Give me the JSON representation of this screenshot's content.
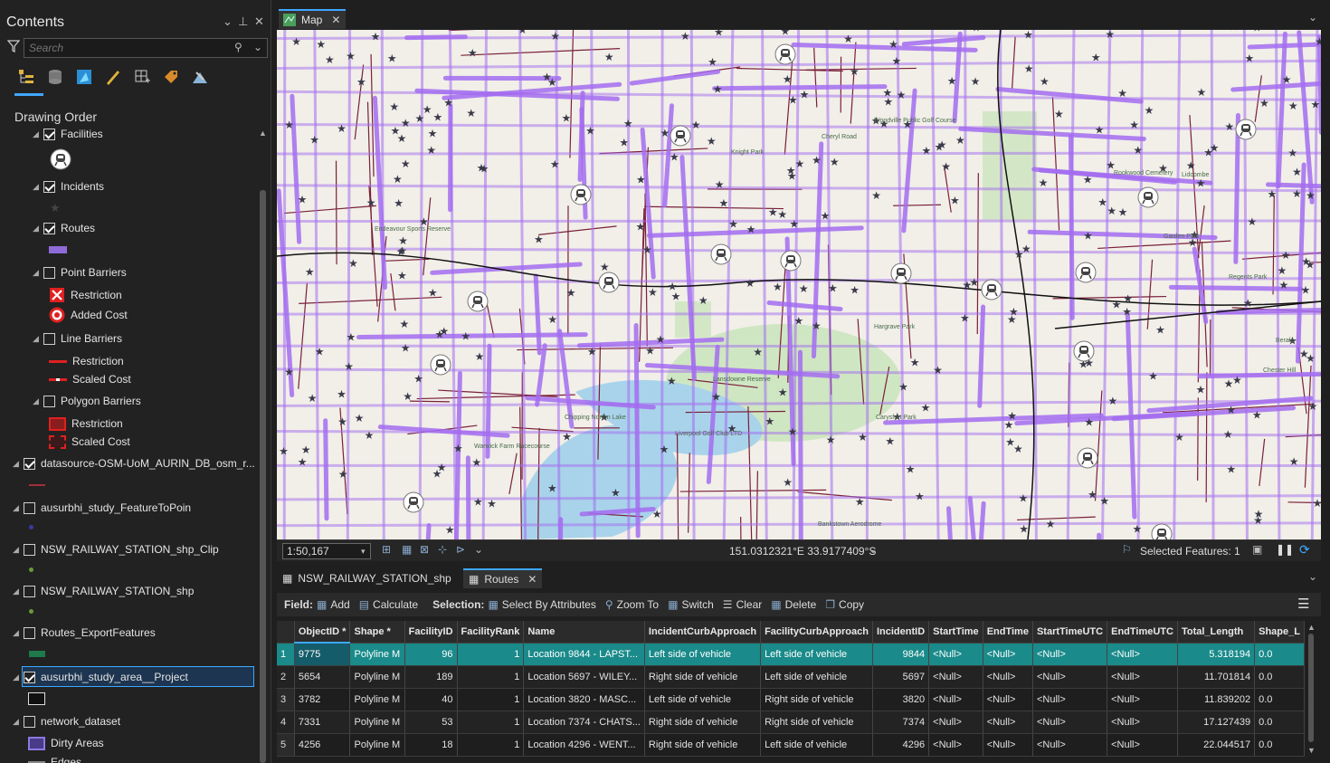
{
  "contents": {
    "title": "Contents",
    "search_placeholder": "Search",
    "drawing_order_label": "Drawing Order",
    "items": [
      {
        "label": "Facilities",
        "checked": true
      },
      {
        "label": "Incidents",
        "checked": true
      },
      {
        "label": "Routes",
        "checked": true
      },
      {
        "label": "Point Barriers",
        "checked": false
      },
      {
        "label": "Restriction"
      },
      {
        "label": "Added Cost"
      },
      {
        "label": "Line Barriers",
        "checked": false
      },
      {
        "label": "Restriction"
      },
      {
        "label": "Scaled Cost"
      },
      {
        "label": "Polygon Barriers",
        "checked": false
      },
      {
        "label": "Restriction"
      },
      {
        "label": "Scaled Cost"
      },
      {
        "label": "datasource-OSM-UoM_AURIN_DB_osm_r...",
        "checked": true
      },
      {
        "label": "ausurbhi_study_FeatureToPoin",
        "checked": false
      },
      {
        "label": "NSW_RAILWAY_STATION_shp_Clip",
        "checked": false
      },
      {
        "label": "NSW_RAILWAY_STATION_shp",
        "checked": false
      },
      {
        "label": "Routes_ExportFeatures",
        "checked": false
      },
      {
        "label": "ausurbhi_study_area__Project",
        "checked": true
      },
      {
        "label": "network_dataset",
        "checked": false
      },
      {
        "label": "Dirty Areas"
      },
      {
        "label": "Edges"
      }
    ]
  },
  "map": {
    "tab_label": "Map",
    "scale": "1:50,167",
    "coordinates": "151.0312321°E 33.9177409°S",
    "selected_features": "Selected Features: 1",
    "place_labels": [
      "Lansdowne Reserve",
      "Chipping Norton Lake",
      "Warwick Farm Racecourse",
      "Liverpool Golf Club LTD",
      "Bankstown Aerodrome",
      "Woodville Public Golf Course",
      "Knight Park",
      "Endeavour Sports Reserve",
      "Cheryl Road",
      "Carysfort Park",
      "Hargrave Park",
      "Chester Hill",
      "Garden Park",
      "Regents Park",
      "Berala",
      "Lidcombe",
      "Rookwood Cemetery"
    ]
  },
  "table": {
    "tabs": [
      "NSW_RAILWAY_STATION_shp",
      "Routes"
    ],
    "toolbar": {
      "field_label": "Field:",
      "add": "Add",
      "calculate": "Calculate",
      "selection_label": "Selection:",
      "select_by_attributes": "Select By Attributes",
      "zoom_to": "Zoom To",
      "switch": "Switch",
      "clear": "Clear",
      "delete": "Delete",
      "copy": "Copy"
    },
    "columns": [
      "ObjectID *",
      "Shape *",
      "FacilityID",
      "FacilityRank",
      "Name",
      "IncidentCurbApproach",
      "FacilityCurbApproach",
      "IncidentID",
      "StartTime",
      "EndTime",
      "StartTimeUTC",
      "EndTimeUTC",
      "Total_Length",
      "Shape_L"
    ],
    "rows": [
      [
        "1",
        "9775",
        "Polyline M",
        "96",
        "1",
        "Location 9844 - LAPST...",
        "Left side of vehicle",
        "Left side of vehicle",
        "9844",
        "<Null>",
        "<Null>",
        "<Null>",
        "<Null>",
        "5.318194",
        "0.0"
      ],
      [
        "2",
        "5654",
        "Polyline M",
        "189",
        "1",
        "Location 5697 - WILEY...",
        "Right side of vehicle",
        "Left side of vehicle",
        "5697",
        "<Null>",
        "<Null>",
        "<Null>",
        "<Null>",
        "11.701814",
        "0.0"
      ],
      [
        "3",
        "3782",
        "Polyline M",
        "40",
        "1",
        "Location 3820 - MASC...",
        "Left side of vehicle",
        "Right side of vehicle",
        "3820",
        "<Null>",
        "<Null>",
        "<Null>",
        "<Null>",
        "11.839202",
        "0.0"
      ],
      [
        "4",
        "7331",
        "Polyline M",
        "53",
        "1",
        "Location 7374 - CHATS...",
        "Right side of vehicle",
        "Right side of vehicle",
        "7374",
        "<Null>",
        "<Null>",
        "<Null>",
        "<Null>",
        "17.127439",
        "0.0"
      ],
      [
        "5",
        "4256",
        "Polyline M",
        "18",
        "1",
        "Location 4296 - WENT...",
        "Right side of vehicle",
        "Left side of vehicle",
        "4296",
        "<Null>",
        "<Null>",
        "<Null>",
        "<Null>",
        "22.044517",
        "0.0"
      ]
    ]
  },
  "colors": {
    "route": "#a36cf0",
    "road": "#7a1f3a",
    "accent": "#3fa7ff",
    "selected_row": "#1a8a8a"
  }
}
